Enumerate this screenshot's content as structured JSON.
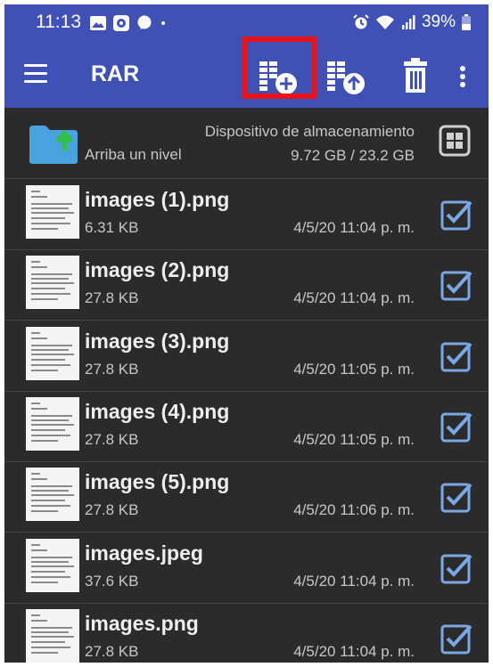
{
  "status_bar": {
    "time": "11:13",
    "battery": "39%"
  },
  "toolbar": {
    "title": "RAR",
    "icons": [
      "menu-icon",
      "add-to-archive-icon",
      "extract-icon",
      "trash-icon",
      "more-vert-icon"
    ]
  },
  "up_folder": {
    "label": "Arriba un nivel",
    "device": "Dispositivo de almacenamiento",
    "storage": "9.72 GB / 23.2 GB"
  },
  "files": [
    {
      "name": "images (1).png",
      "size": "6.31 KB",
      "date": "4/5/20 11:04 p. m.",
      "checked": true
    },
    {
      "name": "images (2).png",
      "size": "27.8 KB",
      "date": "4/5/20 11:04 p. m.",
      "checked": true
    },
    {
      "name": "images (3).png",
      "size": "27.8 KB",
      "date": "4/5/20 11:05 p. m.",
      "checked": true
    },
    {
      "name": "images (4).png",
      "size": "27.8 KB",
      "date": "4/5/20 11:05 p. m.",
      "checked": true
    },
    {
      "name": "images (5).png",
      "size": "27.8 KB",
      "date": "4/5/20 11:06 p. m.",
      "checked": true
    },
    {
      "name": "images.jpeg",
      "size": "37.6 KB",
      "date": "4/5/20 11:04 p. m.",
      "checked": true
    },
    {
      "name": "images.png",
      "size": "27.8 KB",
      "date": "4/5/20 11:04 p. m.",
      "checked": true
    }
  ],
  "colors": {
    "toolbar": "#3f51b5",
    "background": "#2b2b2b",
    "highlight": "#e8141b",
    "checkbox": "#7aa8e4",
    "folder": "#4aa3df",
    "folder_arrow": "#2fbf4a"
  }
}
